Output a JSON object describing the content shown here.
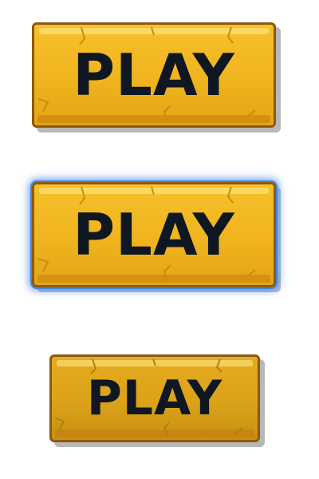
{
  "buttons": {
    "normal": {
      "label": "PLAY",
      "state": "normal"
    },
    "hover": {
      "label": "PLAY",
      "state": "highlighted"
    },
    "pressed": {
      "label": "PLAY",
      "state": "pressed"
    }
  },
  "colors": {
    "button_face": "#f0b41f",
    "button_border": "#8a5a12",
    "label_text": "#0f1720",
    "highlight_glow": "#3f86e6",
    "background": "#ffffff"
  }
}
